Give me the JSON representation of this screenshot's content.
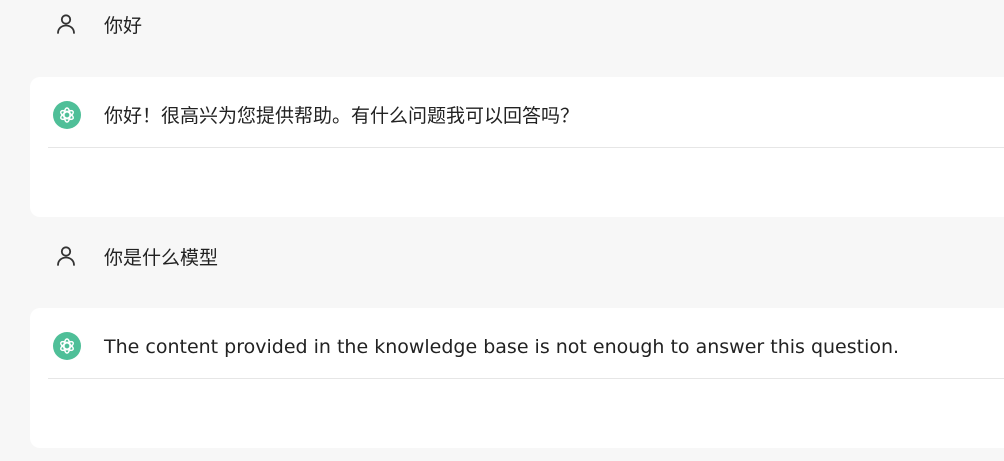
{
  "conversation": [
    {
      "role": "user",
      "avatar_icon": "user-icon",
      "text": "你好"
    },
    {
      "role": "assistant",
      "avatar_icon": "openai-logo-icon",
      "text": "你好！很高兴为您提供帮助。有什么问题我可以回答吗？"
    },
    {
      "role": "user",
      "avatar_icon": "user-icon",
      "text": "你是什么模型"
    },
    {
      "role": "assistant",
      "avatar_icon": "openai-logo-icon",
      "text": "The content provided in the knowledge base is not enough to answer this question."
    }
  ],
  "colors": {
    "page_background": "#f7f7f7",
    "assistant_bubble": "#ffffff",
    "assistant_avatar": "#4fbf98",
    "text": "#222222",
    "divider": "#e6e6e6"
  }
}
